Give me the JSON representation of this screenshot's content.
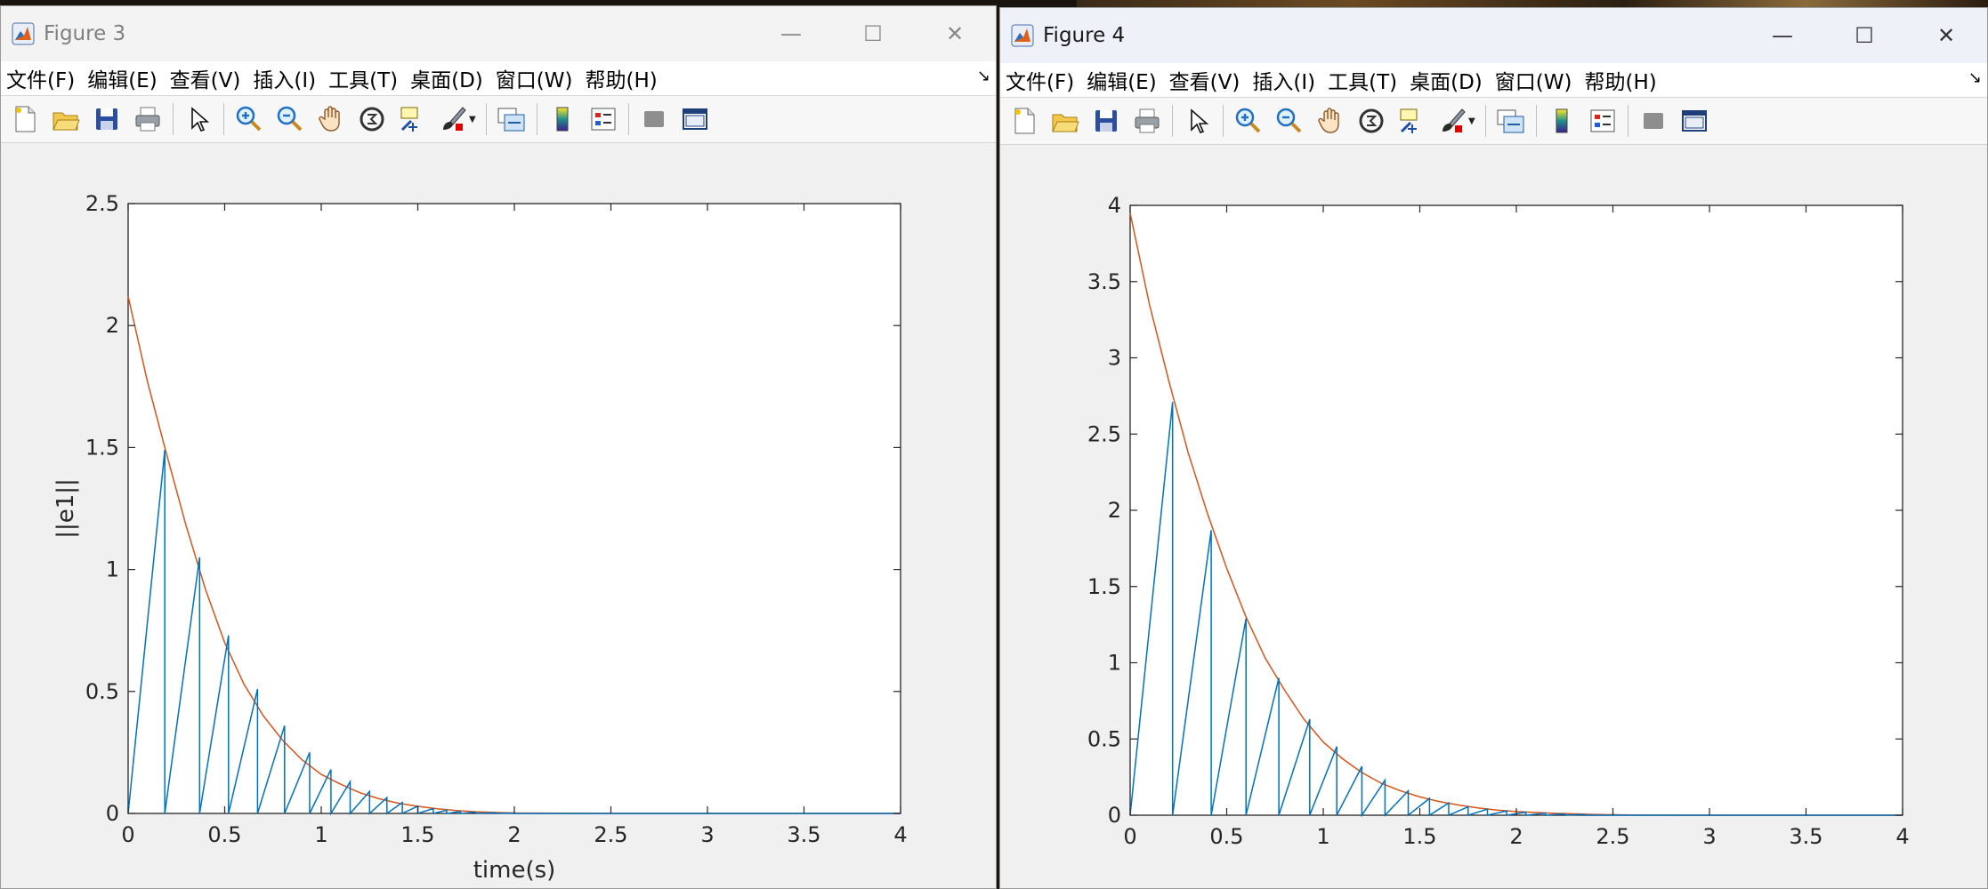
{
  "figures": [
    {
      "title": "Figure 3",
      "menu": [
        "文件(F)",
        "编辑(E)",
        "查看(V)",
        "插入(I)",
        "工具(T)",
        "桌面(D)",
        "窗口(W)",
        "帮助(H)"
      ],
      "toolbar_icons": [
        "new-figure-icon",
        "open-file-icon",
        "save-icon",
        "print-icon",
        "select-arrow-icon",
        "zoom-in-icon",
        "zoom-out-icon",
        "pan-hand-icon",
        "rotate-3d-icon",
        "data-cursor-icon",
        "brush-icon",
        "link-plot-icon",
        "colorbar-icon",
        "legend-icon",
        "hide-plot-tools-icon",
        "show-plot-tools-icon"
      ],
      "window_buttons": [
        "—",
        "☐",
        "✕"
      ]
    },
    {
      "title": "Figure 4",
      "menu": [
        "文件(F)",
        "编辑(E)",
        "查看(V)",
        "插入(I)",
        "工具(T)",
        "桌面(D)",
        "窗口(W)",
        "帮助(H)"
      ],
      "toolbar_icons": [
        "new-figure-icon",
        "open-file-icon",
        "save-icon",
        "print-icon",
        "select-arrow-icon",
        "zoom-in-icon",
        "zoom-out-icon",
        "pan-hand-icon",
        "rotate-3d-icon",
        "data-cursor-icon",
        "brush-icon",
        "link-plot-icon",
        "colorbar-icon",
        "legend-icon",
        "hide-plot-tools-icon",
        "show-plot-tools-icon"
      ],
      "window_buttons": [
        "—",
        "☐",
        "✕"
      ]
    }
  ],
  "chart_data": [
    {
      "type": "line",
      "title": "",
      "xlabel": "time(s)",
      "ylabel": "||e1||",
      "xlim": [
        0,
        4
      ],
      "ylim": [
        0,
        2.5
      ],
      "xticks": [
        "0",
        "0.5",
        "1",
        "1.5",
        "2",
        "2.5",
        "3",
        "3.5",
        "4"
      ],
      "yticks": [
        "0",
        "0.5",
        "1",
        "1.5",
        "2",
        "2.5"
      ],
      "grid": false,
      "series": [
        {
          "color": "#d95319",
          "type": "smooth-decay",
          "x": [
            0,
            0.1,
            0.2,
            0.3,
            0.4,
            0.5,
            0.6,
            0.7,
            0.8,
            0.9,
            1.0,
            1.1,
            1.2,
            1.3,
            1.4,
            1.5,
            1.6,
            1.7,
            1.8,
            1.9,
            2.0,
            2.2,
            2.5,
            3.0,
            3.5,
            4.0
          ],
          "y": [
            2.12,
            1.77,
            1.47,
            1.18,
            0.92,
            0.7,
            0.53,
            0.4,
            0.3,
            0.22,
            0.16,
            0.12,
            0.085,
            0.06,
            0.042,
            0.029,
            0.019,
            0.012,
            0.007,
            0.004,
            0.002,
            0.001,
            0,
            0,
            0,
            0
          ]
        },
        {
          "color": "#0072bd",
          "type": "sawtooth",
          "x": [
            0,
            0.19,
            0.19,
            0.37,
            0.37,
            0.52,
            0.52,
            0.67,
            0.67,
            0.81,
            0.81,
            0.94,
            0.94,
            1.05,
            1.05,
            1.15,
            1.15,
            1.25,
            1.25,
            1.34,
            1.34,
            1.42,
            1.42,
            1.5,
            1.5,
            1.58,
            1.58,
            1.65,
            1.65,
            1.72,
            1.72,
            1.8,
            1.8,
            1.9,
            1.9,
            2.0,
            2.0,
            4.0
          ],
          "y": [
            0,
            1.49,
            0,
            1.05,
            0,
            0.73,
            0,
            0.51,
            0,
            0.36,
            0,
            0.25,
            0,
            0.18,
            0,
            0.13,
            0,
            0.09,
            0,
            0.065,
            0,
            0.045,
            0,
            0.03,
            0,
            0.02,
            0,
            0.013,
            0,
            0.008,
            0,
            0.005,
            0,
            0.003,
            0,
            0.002,
            0,
            0
          ]
        }
      ]
    },
    {
      "type": "line",
      "title": "",
      "xlabel": "",
      "ylabel": "",
      "xlim": [
        0,
        4
      ],
      "ylim": [
        0,
        4
      ],
      "xticks": [
        "0",
        "0.5",
        "1",
        "1.5",
        "2",
        "2.5",
        "3",
        "3.5",
        "4"
      ],
      "yticks": [
        "0",
        "0.5",
        "1",
        "1.5",
        "2",
        "2.5",
        "3",
        "3.5",
        "4"
      ],
      "grid": false,
      "series": [
        {
          "color": "#d95319",
          "type": "smooth-decay",
          "x": [
            0,
            0.1,
            0.2,
            0.3,
            0.4,
            0.5,
            0.6,
            0.7,
            0.8,
            0.9,
            1.0,
            1.1,
            1.2,
            1.3,
            1.4,
            1.5,
            1.6,
            1.7,
            1.8,
            1.9,
            2.0,
            2.2,
            2.4,
            2.6,
            3.0,
            3.5,
            4.0
          ],
          "y": [
            3.95,
            3.35,
            2.85,
            2.38,
            1.98,
            1.62,
            1.3,
            1.03,
            0.82,
            0.63,
            0.48,
            0.37,
            0.28,
            0.21,
            0.16,
            0.12,
            0.09,
            0.067,
            0.048,
            0.034,
            0.024,
            0.012,
            0.005,
            0.002,
            0,
            0,
            0
          ]
        },
        {
          "color": "#0072bd",
          "type": "sawtooth",
          "x": [
            0,
            0.22,
            0.22,
            0.42,
            0.42,
            0.6,
            0.6,
            0.77,
            0.77,
            0.93,
            0.93,
            1.07,
            1.07,
            1.2,
            1.2,
            1.32,
            1.32,
            1.44,
            1.44,
            1.55,
            1.55,
            1.65,
            1.65,
            1.75,
            1.75,
            1.85,
            1.85,
            1.95,
            1.95,
            2.05,
            2.05,
            2.15,
            2.15,
            2.25,
            2.25,
            2.35,
            2.35,
            4.0
          ],
          "y": [
            0,
            2.71,
            0,
            1.87,
            0,
            1.29,
            0,
            0.9,
            0,
            0.63,
            0,
            0.45,
            0,
            0.32,
            0,
            0.23,
            0,
            0.16,
            0,
            0.11,
            0,
            0.08,
            0,
            0.055,
            0,
            0.04,
            0,
            0.028,
            0,
            0.02,
            0,
            0.013,
            0,
            0.008,
            0,
            0.005,
            0,
            0
          ]
        }
      ]
    }
  ]
}
